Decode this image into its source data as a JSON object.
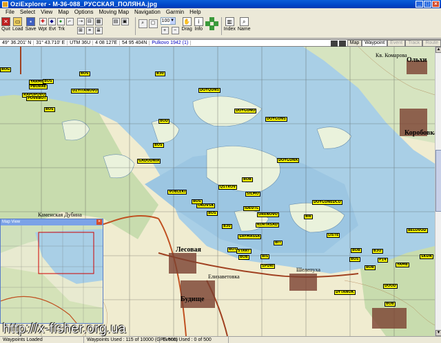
{
  "window": {
    "title": "OziExplorer - M-36-088_РУССКАЯ_ПОЛЯНА.jpg",
    "minimize": "_",
    "maximize": "□",
    "close": "×"
  },
  "menu": [
    "File",
    "Select",
    "View",
    "Map",
    "Options",
    "Moving Map",
    "Navigation",
    "Garmin",
    "Help"
  ],
  "toolbar": {
    "quit": "Quit",
    "load": "Load",
    "save": "Save",
    "waypoint_labels": [
      "Wpt",
      "Evt",
      "Trk"
    ],
    "zoom_value": "100",
    "drag": "Drag",
    "info": "Info",
    "index": "Index",
    "name": "Name"
  },
  "coords": {
    "lat": "49° 36.201' N",
    "lon": "31° 43.710' E",
    "utm": "UTM  36U",
    "easting": "4 08 127E",
    "northing": "54 95 404N",
    "datum": "Pulkovo 1942 (1)"
  },
  "coord_tabs": [
    {
      "label": "Map",
      "state": "normal"
    },
    {
      "label": "Waypoint",
      "state": "active"
    },
    {
      "label": "Event",
      "state": "disabled"
    },
    {
      "label": "Track",
      "state": "disabled"
    },
    {
      "label": "Route",
      "state": "disabled"
    }
  ],
  "map_labels": {
    "olkhi": "Ольхи",
    "korobovka": "Коробовка",
    "lesovaya": "Лесовая",
    "budische": "Будище",
    "elizavetovka": "Елизаветовка",
    "kamenska": "Каменская Дубина",
    "shelepuha": "Шелепуха",
    "kv_komarova": "Кв. Комарова"
  },
  "waypoints": [
    "BOG",
    "YARMIC",
    "PBORAE",
    "RAPOPOVO",
    "POVRBOT",
    "BOS",
    "BOS",
    "DOYQUNS",
    "DZYITANOVO",
    "BOS",
    "B30",
    "DOYGUNO",
    "DOYGUNS",
    "DOYGUNA",
    "BOD",
    "GADODNIA",
    "BOS",
    "VOBLEKI",
    "QSTROV",
    "BOB",
    "OKOVSK",
    "DOYGUNEDCO",
    "IDEUTL",
    "SILMO",
    "BIE",
    "BOS",
    "ORENOVO",
    "B30",
    "KORTASAD",
    "BOS",
    "SAYMASSA",
    "LISTE",
    "BIT",
    "BOT",
    "BIS",
    "START",
    "BOB",
    "BOB",
    "SPURI",
    "BOS",
    "B3O",
    "BOB",
    "BELOVOD",
    "P14",
    "YAMB",
    "SKUN",
    "DOOD",
    "DYTANOK",
    "BOB"
  ],
  "mapview": {
    "title": "Map View",
    "close": "×"
  },
  "watermark": "http://x-fisher.org.ua",
  "status": {
    "loaded": "Waypoints Loaded",
    "used": "Waypoints Used :  115 of 10000  (GPS 500)",
    "events": "Events Used : 0 of 500"
  }
}
